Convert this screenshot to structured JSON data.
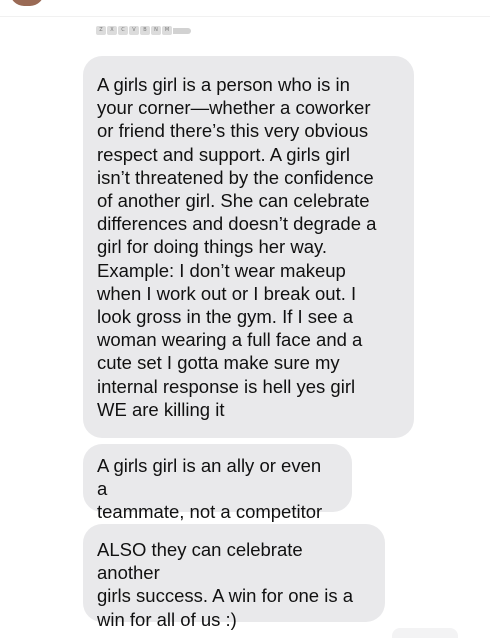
{
  "conversation": {
    "sticker": {
      "keys": [
        "Z",
        "X",
        "C",
        "V",
        "B",
        "N",
        "M"
      ]
    },
    "messages": [
      {
        "direction": "incoming",
        "text": "A girls girl is a person who is in\nyour corner—whether a coworker\nor friend there’s this very obvious\nrespect and support. A girls girl\nisn’t threatened by the confidence\nof another girl. She can celebrate\ndifferences and doesn’t degrade a\ngirl for doing things her way.\nExample: I don’t wear makeup\nwhen I work out or I break out. I\nlook gross in the gym. If I see a\nwoman wearing a full face and a\ncute set I gotta make sure my\ninternal response is hell yes girl\nWE are killing it"
      },
      {
        "direction": "incoming",
        "text": "A girls girl is an ally or even a\nteammate, not a competitor"
      },
      {
        "direction": "incoming",
        "text": "ALSO they can celebrate another\ngirls success. A win for one is a\nwin for all of us :)"
      }
    ]
  },
  "colors": {
    "incoming_bubble": "#e9e9eb",
    "outgoing_bubble": "#1e88f5",
    "text": "#111111",
    "background": "#ffffff"
  }
}
